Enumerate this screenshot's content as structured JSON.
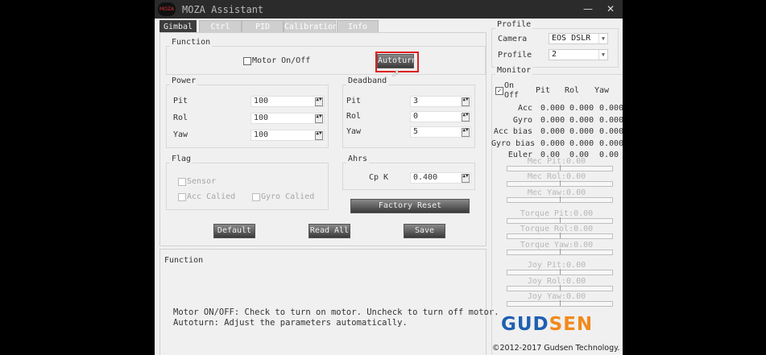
{
  "window": {
    "title": "MOZA Assistant",
    "logo_text": "MOZA",
    "min_glyph": "—",
    "close_glyph": "✕"
  },
  "tabs": [
    {
      "label": "Gimbal",
      "active": true
    },
    {
      "label": "Ctrl",
      "active": false
    },
    {
      "label": "PID",
      "active": false
    },
    {
      "label": "Calibration",
      "active": false
    },
    {
      "label": "Info",
      "active": false
    }
  ],
  "function_group": {
    "title": "Function",
    "motor_label": "Motor On/Off",
    "motor_checked": false,
    "autoturn_label": "Autoturn"
  },
  "power": {
    "title": "Power",
    "rows": [
      {
        "label": "Pit",
        "value": "100"
      },
      {
        "label": "Rol",
        "value": "100"
      },
      {
        "label": "Yaw",
        "value": "100"
      }
    ]
  },
  "deadband": {
    "title": "Deadband",
    "rows": [
      {
        "label": "Pit",
        "value": "3"
      },
      {
        "label": "Rol",
        "value": "0"
      },
      {
        "label": "Yaw",
        "value": "5"
      }
    ]
  },
  "flag": {
    "title": "Flag",
    "sensor": "Sensor",
    "acc_calied": "Acc Calied",
    "gyro_calied": "Gyro Calied"
  },
  "ahrs": {
    "title": "Ahrs",
    "cpk_label": "Cp K",
    "cpk_value": "0.400"
  },
  "buttons": {
    "factory_reset": "Factory Reset",
    "default": "Default",
    "read_all": "Read All",
    "save": "Save"
  },
  "description": {
    "title": "Function",
    "line1": "Motor ON/OFF: Check to turn on motor. Uncheck to turn off motor.",
    "line2": "Autoturn: Adjust the parameters automatically."
  },
  "profile": {
    "title": "Profile",
    "camera_label": "Camera",
    "camera_value": "EOS DSLR",
    "profile_label": "Profile",
    "profile_value": "2"
  },
  "monitor": {
    "title": "Monitor",
    "on_label": "On",
    "off_label": "Off",
    "on_checked": true,
    "columns": [
      "Pit",
      "Rol",
      "Yaw"
    ],
    "rows": [
      {
        "label": "Acc",
        "values": [
          "0.000",
          "0.000",
          "0.000"
        ]
      },
      {
        "label": "Gyro",
        "values": [
          "0.000",
          "0.000",
          "0.000"
        ]
      },
      {
        "label": "Acc bias",
        "values": [
          "0.000",
          "0.000",
          "0.000"
        ]
      },
      {
        "label": "Gyro bias",
        "values": [
          "0.000",
          "0.000",
          "0.000"
        ]
      },
      {
        "label": "Euler",
        "values": [
          "0.00",
          "0.00",
          "0.00"
        ]
      }
    ],
    "sliders": [
      {
        "label": "Mec Pit:0.00"
      },
      {
        "label": "Mec Rol:0.00"
      },
      {
        "label": "Mec Yaw:0.00"
      },
      {
        "label": "Torque Pit:0.00"
      },
      {
        "label": "Torque Rol:0.00"
      },
      {
        "label": "Torque Yaw:0.00"
      },
      {
        "label": "Joy Pit:0.00"
      },
      {
        "label": "Joy Rol:0.00"
      },
      {
        "label": "Joy Yaw:0.00"
      }
    ]
  },
  "brand": {
    "logo_text": "GUDSEN",
    "copyright": "©2012-2017 Gudsen Technology.",
    "color_blue": "#1f5fb0",
    "color_orange": "#f08a1c"
  },
  "accent": {
    "highlight_box": "#e0201c"
  }
}
